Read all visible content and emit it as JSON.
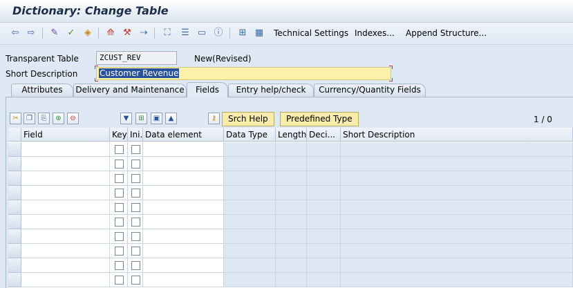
{
  "window": {
    "title": "Dictionary: Change Table"
  },
  "toolbar": {
    "technical_settings": "Technical Settings",
    "indexes": "Indexes...",
    "append_structure": "Append Structure..."
  },
  "header": {
    "table_type_label": "Transparent Table",
    "table_name": "ZCUST_REV",
    "status": "New(Revised)",
    "short_desc_label": "Short Description",
    "short_desc_value": "Customer Revenue"
  },
  "tabs": [
    {
      "label": "Attributes"
    },
    {
      "label": "Delivery and Maintenance"
    },
    {
      "label": "Fields",
      "active": true
    },
    {
      "label": "Entry help/check"
    },
    {
      "label": "Currency/Quantity Fields"
    }
  ],
  "table_toolbar": {
    "srch_help": "Srch Help",
    "predefined_type": "Predefined Type",
    "counter": "1 / 0"
  },
  "grid": {
    "columns": [
      "Field",
      "Key",
      "Ini...",
      "Data element",
      "Data Type",
      "Length",
      "Deci...",
      "Short Description"
    ],
    "row_count": 10
  },
  "colors": {
    "title": "#1c2e4a",
    "highlight": "#fbf1a8",
    "selection": "#28529c"
  },
  "icons": [
    "back-icon",
    "forward-icon",
    "display-change-icon",
    "activate-icon",
    "where-used-icon",
    "object-list-icon",
    "navigation-icon",
    "hierarchy-icon",
    "info-icon",
    "grid-icon"
  ]
}
